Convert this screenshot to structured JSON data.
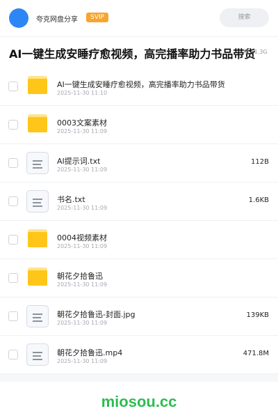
{
  "header": {
    "app_name": "夸克网盘分享",
    "vip_badge": "SVIP",
    "search_label": "搜索"
  },
  "share": {
    "title": "AI一键生成安睡疗愈视频，高完播率助力书品带货",
    "meta": "项 · 1.3G"
  },
  "files": [
    {
      "type": "folder",
      "name": "AI一键生成安睡疗愈视频，高完播率助力书品带货",
      "date": "2025-11-30 11:10",
      "size": ""
    },
    {
      "type": "folder",
      "name": "0003文案素材",
      "date": "2025-11-30 11:09",
      "size": ""
    },
    {
      "type": "file",
      "name": "AI提示词.txt",
      "date": "2025-11-30 11:09",
      "size": "112B"
    },
    {
      "type": "file",
      "name": "书名.txt",
      "date": "2025-11-30 11:09",
      "size": "1.6KB"
    },
    {
      "type": "folder",
      "name": "0004视频素材",
      "date": "2025-11-30 11:09",
      "size": ""
    },
    {
      "type": "folder",
      "name": "朝花夕拾鲁迅",
      "date": "2025-11-30 11:09",
      "size": ""
    },
    {
      "type": "file",
      "name": "朝花夕拾鲁迅-封面.jpg",
      "date": "2025-11-30 11:09",
      "size": "139KB"
    },
    {
      "type": "file",
      "name": "朝花夕拾鲁迅.mp4",
      "date": "2025-11-30 11:09",
      "size": "471.8M"
    }
  ],
  "footer": {
    "watermark": "miosou.cc"
  },
  "colors": {
    "accent": "#2d86f5",
    "vip": "#f7a52f",
    "folder": "#ffc61a",
    "watermark": "#2dbd52"
  }
}
